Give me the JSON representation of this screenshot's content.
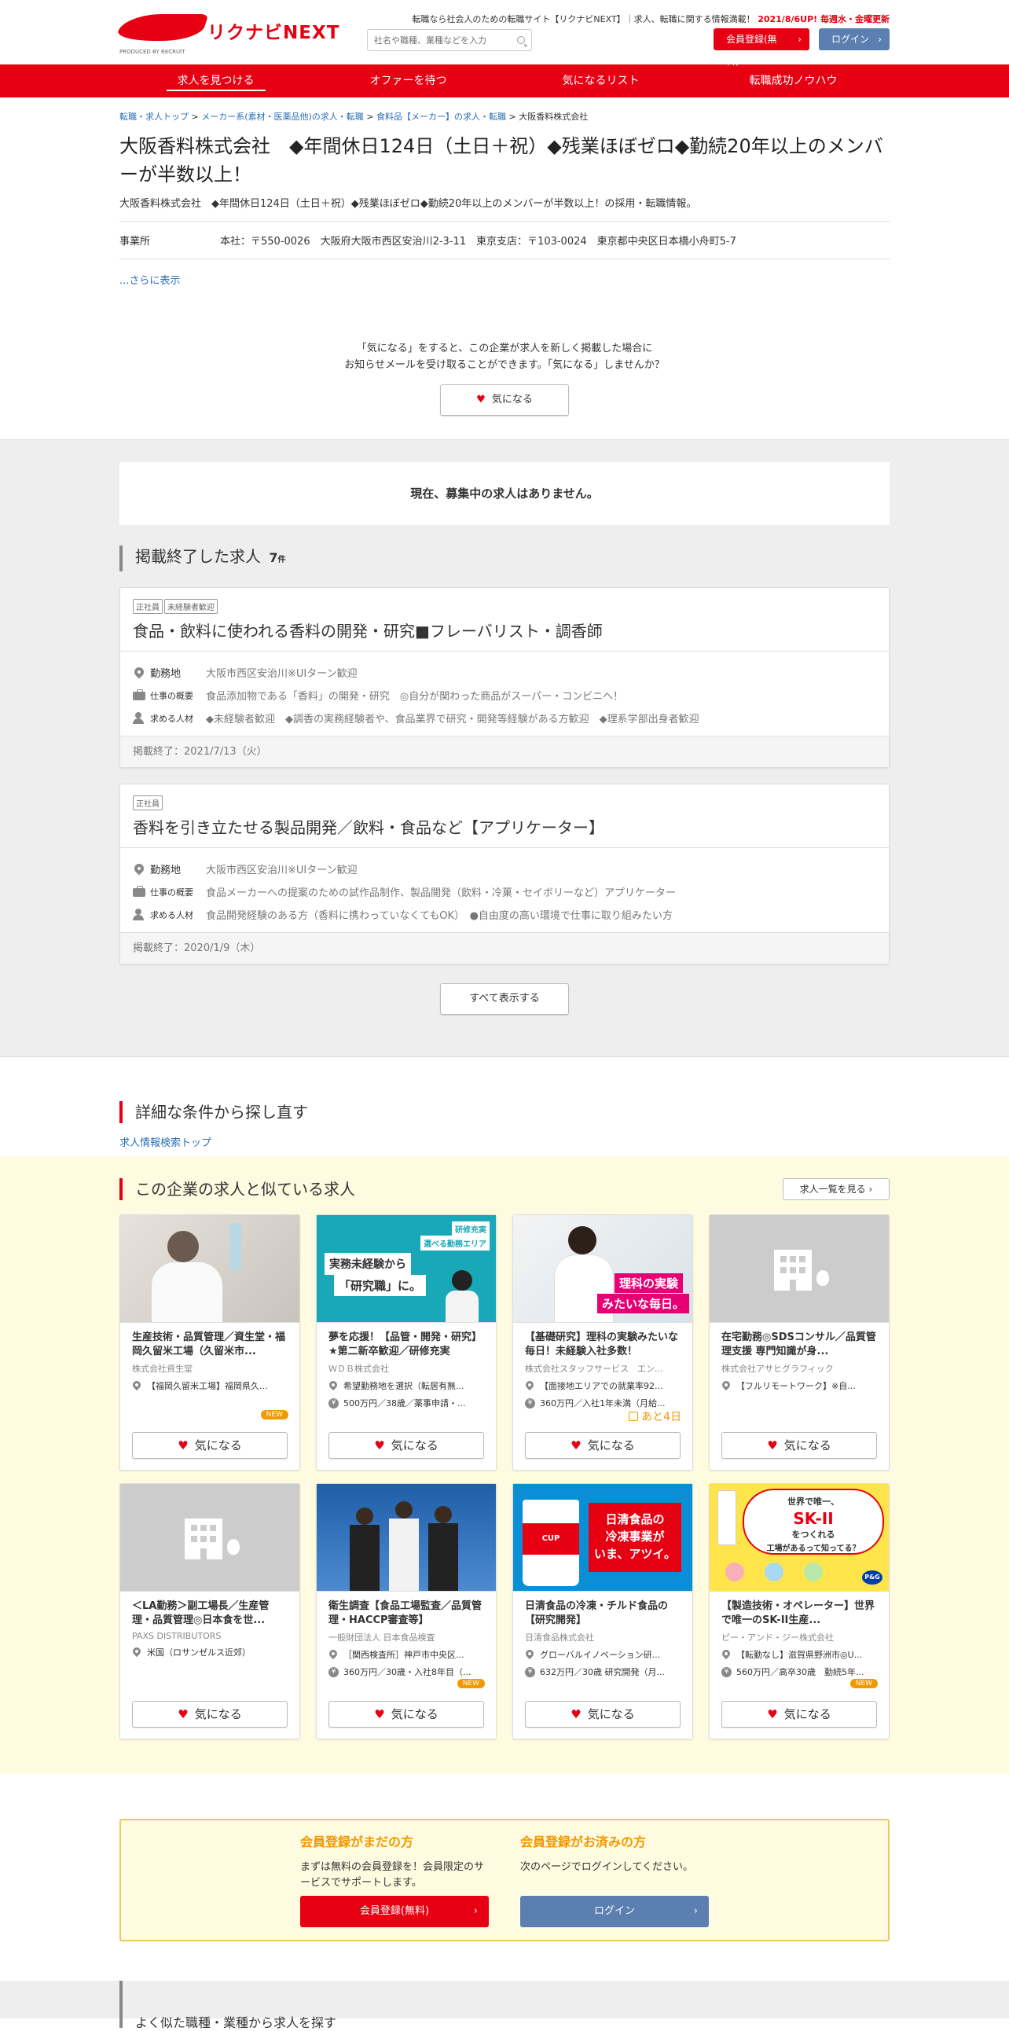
{
  "header": {
    "logo_text": "リクナビNEXT",
    "logo_small": "PRODUCED BY RECRUIT",
    "tagline": "転職なら社会人のための転職サイト【リクナビNEXT】｜求人、転職に関する情報満載！",
    "tagline_update": "2021/8/6UP! 毎週水・金曜更新",
    "search_placeholder": "社名や職種、業種などを入力",
    "register_label": "会員登録(無料)",
    "login_label": "ログイン",
    "colors": {
      "brand": "#e60012",
      "login": "#5a7fb0",
      "accent": "#f39800"
    }
  },
  "nav": [
    {
      "label": "求人を見つける"
    },
    {
      "label": "オファーを待つ"
    },
    {
      "label": "気になるリスト"
    },
    {
      "label": "転職成功ノウハウ"
    }
  ],
  "breadcrumb": [
    "転職・求人トップ",
    "メーカー系(素材・医薬品他)の求人・転職",
    "食料品【メーカー】の求人・転職",
    "大阪香料株式会社"
  ],
  "company": {
    "title": "大阪香料株式会社　◆年間休日124日（土日＋祝）◆残業ほぼゼロ◆勤続20年以上のメンバーが半数以上！",
    "subline": "大阪香料株式会社　◆年間休日124日（土日＋祝）◆残業ほぼゼロ◆勤続20年以上のメンバーが半数以上！の採用・転職情報。",
    "office_label": "事業所",
    "office_value": "本社：〒550-0026　大阪府大阪市西区安治川2-3-11　東京支店：〒103-0024　東京都中央区日本橋小舟町5-7",
    "more_label": "...さらに表示",
    "fav_note_1": "「気になる」をすると、この企業が求人を新しく掲載した場合に",
    "fav_note_2": "お知らせメールを受け取ることができます。「気になる」しませんか？",
    "fav_label": "気になる"
  },
  "jobs": {
    "no_jobs": "現在、募集中の求人はありません。",
    "ended_title": "掲載終了した求人",
    "ended_count": "7",
    "ended_count_unit": "件",
    "labels": {
      "location": "勤務地",
      "summary": "仕事の概要",
      "wanted": "求める人材"
    },
    "items": [
      {
        "tags": [
          "正社員",
          "未経験者歓迎"
        ],
        "title": "食品・飲料に使われる香料の開発・研究■フレーバリスト・調香師",
        "location": "大阪市西区安治川※UIターン歓迎",
        "summary": "食品添加物である「香料」の開発・研究　◎自分が関わった商品がスーパー・コンビニへ！",
        "wanted": "◆未経験者歓迎　◆調香の実務経験者や、食品業界で研究・開発等経験がある方歓迎　◆理系学部出身者歓迎",
        "ended": "掲載終了：2021/7/13（火）"
      },
      {
        "tags": [
          "正社員"
        ],
        "title": "香料を引き立たせる製品開発／飲料・食品など【アプリケーター】",
        "location": "大阪市西区安治川※UIターン歓迎",
        "summary": "食品メーカーへの提案のための試作品制作、製品開発（飲料・冷菓・セイボリーなど）アプリケーター",
        "wanted": "食品開発経験のある方（香料に携わっていなくてもOK）　●自由度の高い環境で仕事に取り組みたい方",
        "ended": "掲載終了：2020/1/9（木）"
      }
    ],
    "show_all": "すべて表示する"
  },
  "refine": {
    "title": "詳細な条件から探し直す",
    "link": "求人情報検索トップ"
  },
  "similar": {
    "title": "この企業の求人と似ている求人",
    "all_label": "求人一覧を見る",
    "fav_label": "気になる",
    "new_label": "NEW",
    "cards": [
      {
        "title": "生産技術・品質管理／資生堂・福岡久留米工場（久留米市...",
        "company": "株式会社資生堂",
        "location": "【福岡久留米工場】福岡県久...",
        "salary": "",
        "badge": "NEW",
        "img": "photo-lab"
      },
      {
        "title": "夢を応援！【品管・開発・研究】★第二新卒歓迎／研修充実",
        "company": "ＷＤＢ株式会社",
        "location": "希望勤務地を選択（転居有無...",
        "salary": "500万円／38歳／薬事申請・...",
        "badge": "",
        "img": "banner-wdb",
        "img_text_1": "実務未経験から",
        "img_text_2": "「研究職」に。",
        "img_text_3": "研修充実",
        "img_text_4": "選べる勤務エリア"
      },
      {
        "title": "【基礎研究】理科の実験みたいな毎日！未経験入社多数！",
        "company": "株式会社スタッフサービス　エン...",
        "location": "【面接地エリアでの就業率92...",
        "salary": "360万円／入社1年未満（月給...",
        "badge": "",
        "deadline": "あと4日",
        "img": "photo-science",
        "img_text_1": "理科の実験",
        "img_text_2": "みたいな毎日。"
      },
      {
        "title": "在宅勤務◎SDSコンサル／品質管理支援 専門知識が身...",
        "company": "株式会社アサヒグラフィック",
        "location": "【フルリモートワーク】※自...",
        "salary": "",
        "badge": "",
        "img": "placeholder"
      },
      {
        "title": "＜LA勤務＞副工場長／生産管理・品質管理◎日本食を世...",
        "company": "PAXS DISTRIBUTORS",
        "location": "米国（ロサンゼルス近郊）",
        "salary": "",
        "badge": "",
        "img": "placeholder"
      },
      {
        "title": "衛生調査【食品工場監査／品質管理・HACCP審査等】",
        "company": "一般財団法人 日本食品検査",
        "location": "［関西検査所］神戸市中央区...",
        "salary": "360万円／30歳・入社8年目（...",
        "badge": "NEW",
        "img": "photo-people"
      },
      {
        "title": "日清食品の冷凍・チルド食品の【研究開発】",
        "company": "日清食品株式会社",
        "location": "グローバルイノベーション研...",
        "salary": "632万円／30歳 研究開発（月...",
        "badge": "",
        "img": "banner-nissin",
        "img_text_1": "日清食品の",
        "img_text_2": "冷凍事業が",
        "img_text_3": "いま、アツイ。",
        "img_text_4": "CUP NOODLE"
      },
      {
        "title": "【製造技術・オペレーター】世界で唯一のSK-II生産...",
        "company": "ピー・アンド・ジー株式会社",
        "location": "【転勤なし】滋賀県野洲市◎U...",
        "salary": "560万円／高卒30歳　勤続5年...",
        "badge": "NEW",
        "img": "banner-skii",
        "img_text_1": "世界で唯一、",
        "img_text_2": "SK-II",
        "img_text_3": "をつくれる",
        "img_text_4": "工場があるって知ってる？",
        "img_text_5": "P&G"
      }
    ]
  },
  "member": {
    "not_yet_title": "会員登録がまだの方",
    "not_yet_text": "まずは無料の会員登録を！会員限定のサービスでサポートします。",
    "not_yet_btn": "会員登録(無料)",
    "done_title": "会員登録がお済みの方",
    "done_text": "次のページでログインしてください。",
    "done_btn": "ログイン"
  },
  "footer_hint": "よく似た職種・業種から求人を探す"
}
